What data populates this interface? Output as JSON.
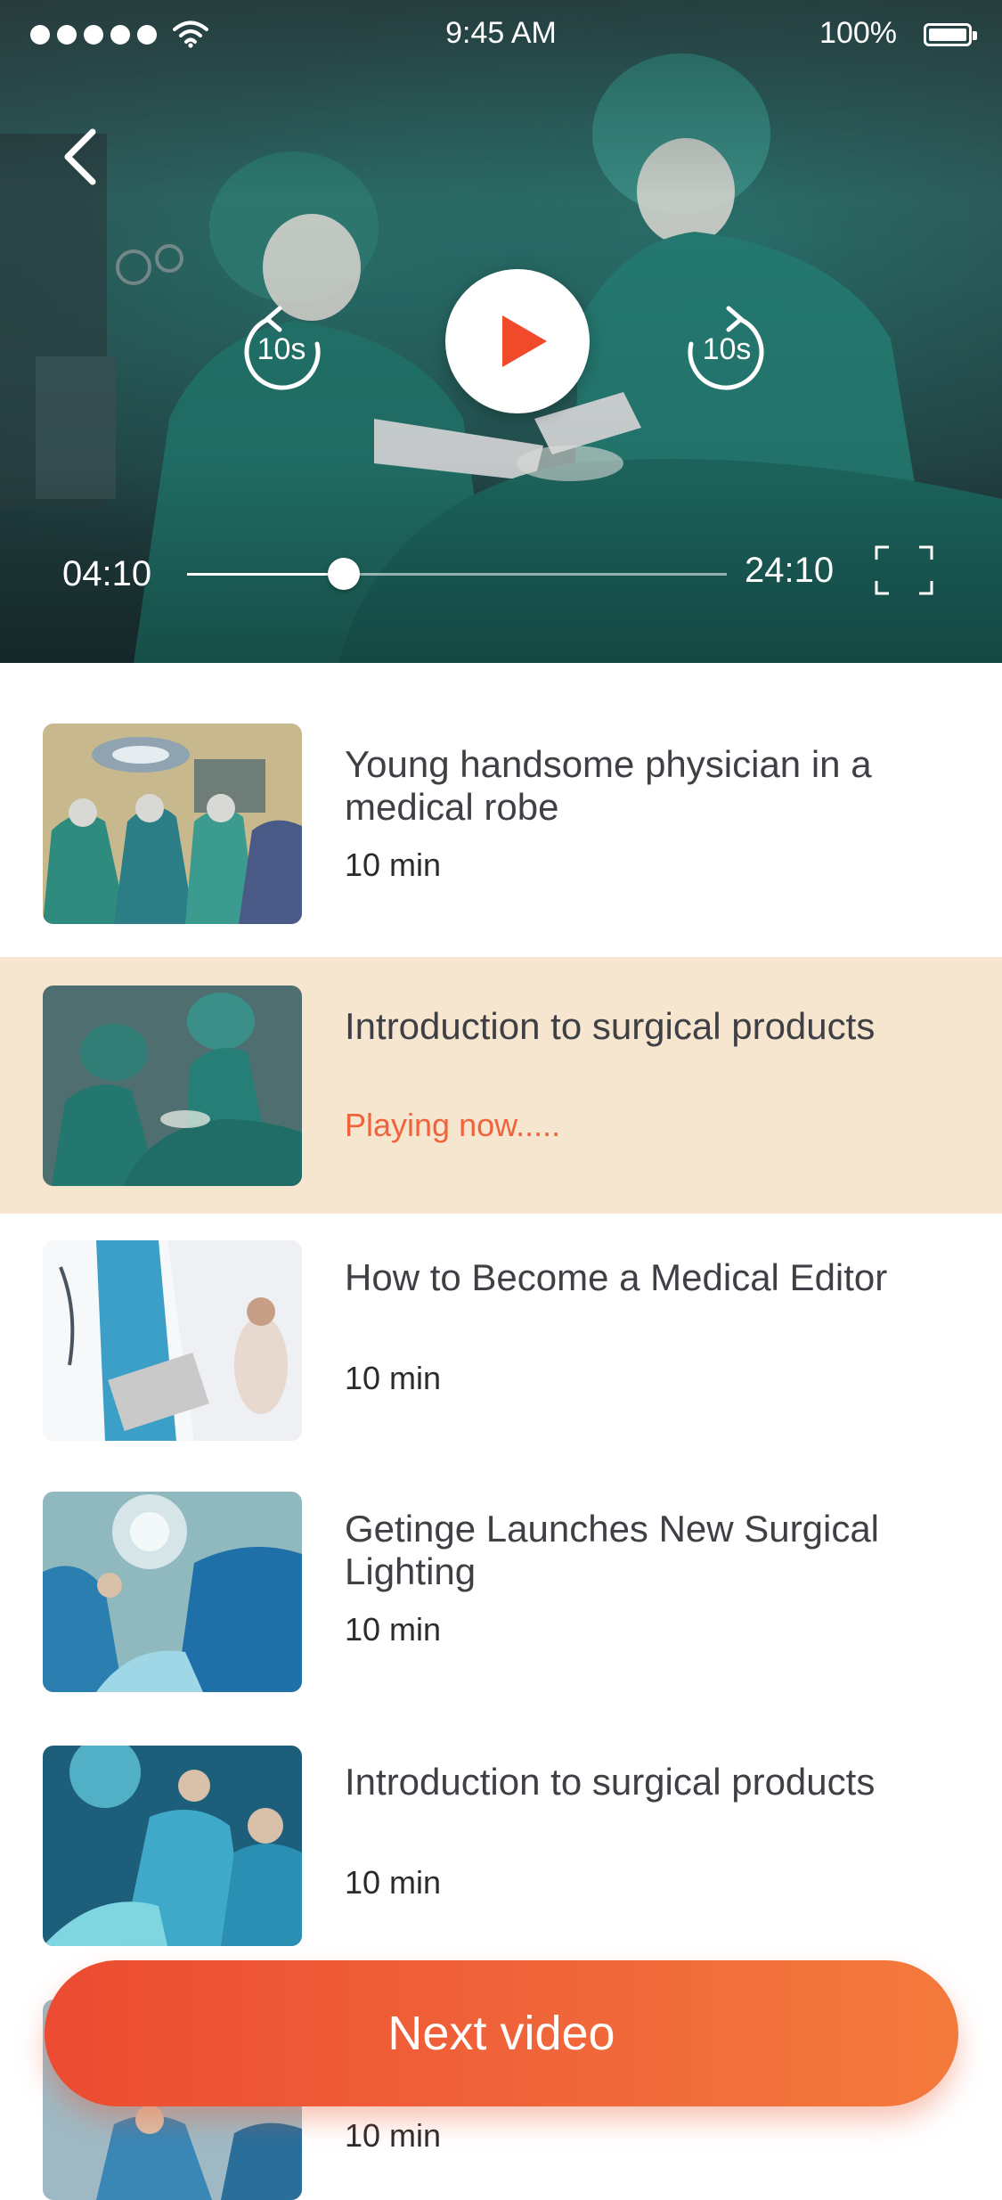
{
  "status_bar": {
    "time": "9:45 AM",
    "battery": "100%"
  },
  "player": {
    "skip_back_label": "10s",
    "skip_forward_label": "10s",
    "elapsed": "04:10",
    "duration": "24:10",
    "progress": 0.29,
    "icons": [
      "back-chevron-icon",
      "replay-10-icon",
      "play-icon",
      "forward-10-icon",
      "fullscreen-icon"
    ]
  },
  "playlist": [
    {
      "title": "Young handsome physician in a medical robe",
      "meta": "10 min",
      "active": false
    },
    {
      "title": "Introduction to surgical products",
      "meta": "Playing now.....",
      "active": true
    },
    {
      "title": "How to Become a Medical Editor",
      "meta": "10 min",
      "active": false
    },
    {
      "title": "Getinge Launches New Surgical Lighting",
      "meta": "10 min",
      "active": false
    },
    {
      "title": "Introduction to surgical products",
      "meta": "10 min",
      "active": false
    },
    {
      "title": "",
      "meta": "10 min",
      "active": false
    }
  ],
  "next_button": {
    "label": "Next video"
  },
  "colors": {
    "accent": "#f0643b",
    "button_start": "#ec4b31",
    "button_end": "#f47a3c",
    "active_row": "#f6e6cf",
    "video_tint": "#2a4a4c"
  }
}
